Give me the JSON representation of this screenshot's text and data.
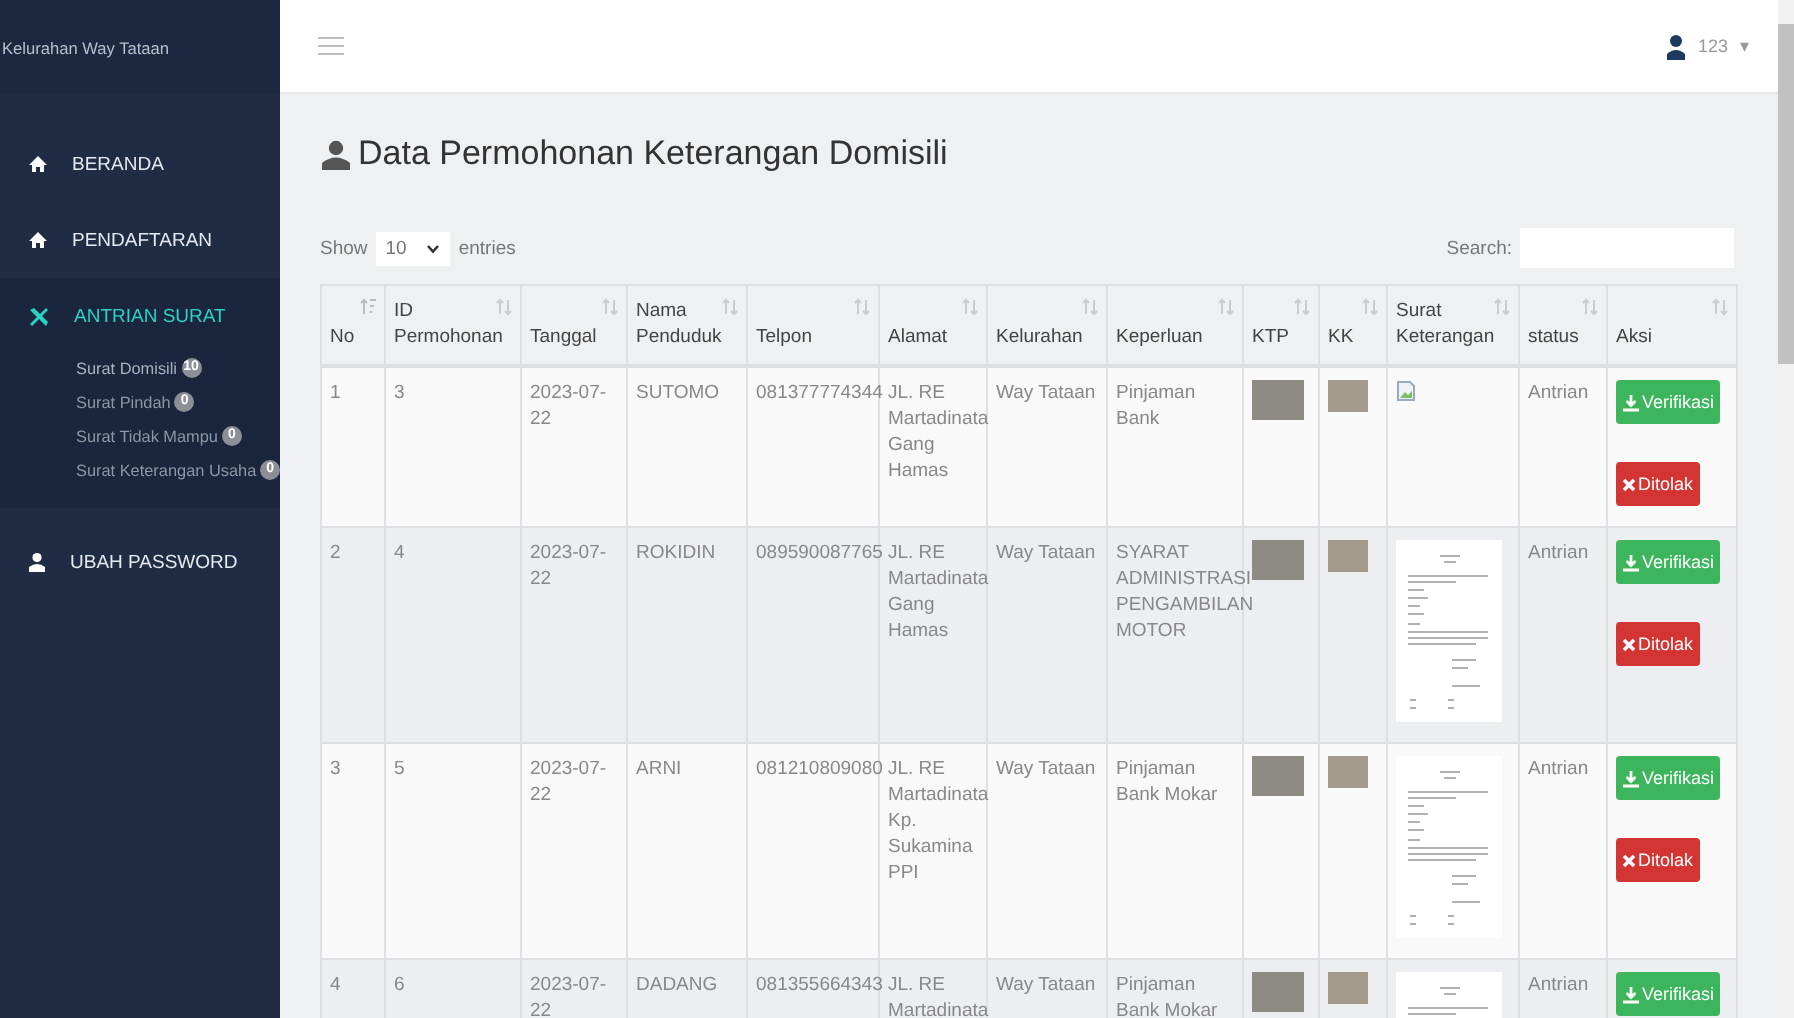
{
  "sidebar": {
    "brand": "Kelurahan Way Tataan",
    "items": [
      {
        "label": "BERANDA",
        "selected": false
      },
      {
        "label": "PENDAFTARAN",
        "selected": false
      },
      {
        "label": "ANTRIAN SURAT",
        "selected": true,
        "children": [
          {
            "label": "Surat Domisili",
            "badge": "10",
            "selected": true
          },
          {
            "label": "Surat Pindah",
            "badge": "0",
            "selected": false
          },
          {
            "label": "Surat Tidak Mampu",
            "badge": "0",
            "selected": false
          },
          {
            "label": "Surat Keterangan Usaha",
            "badge": "0",
            "selected": false
          }
        ]
      },
      {
        "label": "UBAH PASSWORD",
        "selected": false
      }
    ]
  },
  "topbar": {
    "user": "123",
    "caret": "▾"
  },
  "page": {
    "title": "Data Permohonan Keterangan Domisili"
  },
  "table_controls": {
    "show_label": "Show",
    "entries_value": "10",
    "entries_label": "entries",
    "search_label": "Search:"
  },
  "table": {
    "columns": [
      {
        "label": "No"
      },
      {
        "label": "ID Permohonan"
      },
      {
        "label": "Tanggal"
      },
      {
        "label": "Nama Penduduk"
      },
      {
        "label": "Telpon"
      },
      {
        "label": "Alamat"
      },
      {
        "label": "Kelurahan"
      },
      {
        "label": "Keperluan"
      },
      {
        "label": "KTP"
      },
      {
        "label": "KK"
      },
      {
        "label": "Surat Keterangan"
      },
      {
        "label": "status"
      },
      {
        "label": "Aksi"
      }
    ],
    "rows": [
      {
        "no": "1",
        "id": "3",
        "tanggal": "2023-07-22",
        "nama": "SUTOMO",
        "telpon": "081377774344",
        "alamat": "JL. RE Martadinata Gang Hamas",
        "kelurahan": "Way Tataan",
        "keperluan": "Pinjaman Bank",
        "surat": {
          "kind": "broken"
        },
        "status": "Antrian",
        "actions": [
          {
            "kind": "verify",
            "label": "Verifikasi"
          },
          {
            "kind": "reject",
            "label": "Ditolak"
          }
        ]
      },
      {
        "no": "2",
        "id": "4",
        "tanggal": "2023-07-22",
        "nama": "ROKIDIN",
        "telpon": "089590087765",
        "alamat": "JL. RE Martadinata Gang Hamas",
        "kelurahan": "Way Tataan",
        "keperluan": "SYARAT ADMINISTRASI PENGAMBILAN MOTOR",
        "surat": {
          "kind": "document"
        },
        "status": "Antrian",
        "actions": [
          {
            "kind": "verify",
            "label": "Verifikasi"
          },
          {
            "kind": "reject",
            "label": "Ditolak"
          }
        ]
      },
      {
        "no": "3",
        "id": "5",
        "tanggal": "2023-07-22",
        "nama": "ARNI",
        "telpon": "081210809080",
        "alamat": "JL. RE Martadinata Kp. Sukamina PPI",
        "kelurahan": "Way Tataan",
        "keperluan": "Pinjaman Bank Mokar",
        "surat": {
          "kind": "document"
        },
        "status": "Antrian",
        "actions": [
          {
            "kind": "verify",
            "label": "Verifikasi"
          },
          {
            "kind": "reject",
            "label": "Ditolak"
          }
        ]
      },
      {
        "no": "4",
        "id": "6",
        "tanggal": "2023-07-22",
        "nama": "DADANG",
        "telpon": "081355664343",
        "alamat": "JL. RE Martadinata",
        "kelurahan": "Way Tataan",
        "keperluan": "Pinjaman Bank Mokar",
        "surat": {
          "kind": "document"
        },
        "status": "Antrian",
        "actions": [
          {
            "kind": "verify",
            "label": "Verifikasi"
          }
        ]
      }
    ]
  }
}
